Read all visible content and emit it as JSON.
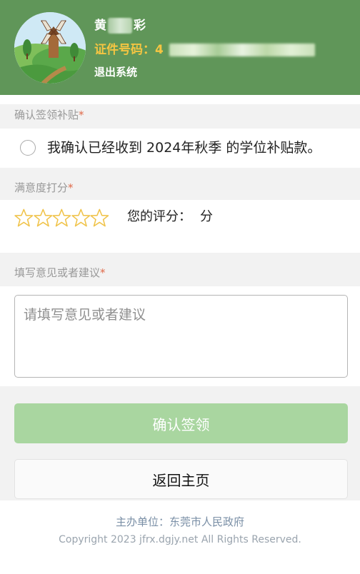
{
  "header": {
    "name_first": "黄",
    "name_last": "彩",
    "id_label": "证件号码：",
    "id_visible_prefix": "4",
    "logout_label": "退出系统"
  },
  "confirm_section": {
    "label": "确认签领补贴",
    "required_mark": "*",
    "statement": "我确认已经收到 2024年秋季 的学位补贴款。"
  },
  "rating_section": {
    "label": "满意度打分",
    "required_mark": "*",
    "stars_total": 5,
    "stars_selected": 0,
    "score_label": "您的评分：",
    "score_unit": "分"
  },
  "feedback_section": {
    "label": "填写意见或者建议",
    "required_mark": "*",
    "placeholder": "请填写意见或者建议"
  },
  "buttons": {
    "confirm_label": "确认签领",
    "back_label": "返回主页"
  },
  "footer": {
    "organizer": "主办单位：东莞市人民政府",
    "copyright": "Copyright 2023 jfrx.dgjy.net All Rights Reserved."
  },
  "colors": {
    "header_bg": "#609659",
    "id_text": "#f5c542",
    "confirm_button_bg": "#a9d6a0",
    "star_outline": "#f0c34a",
    "required_mark": "#e06a4a"
  }
}
